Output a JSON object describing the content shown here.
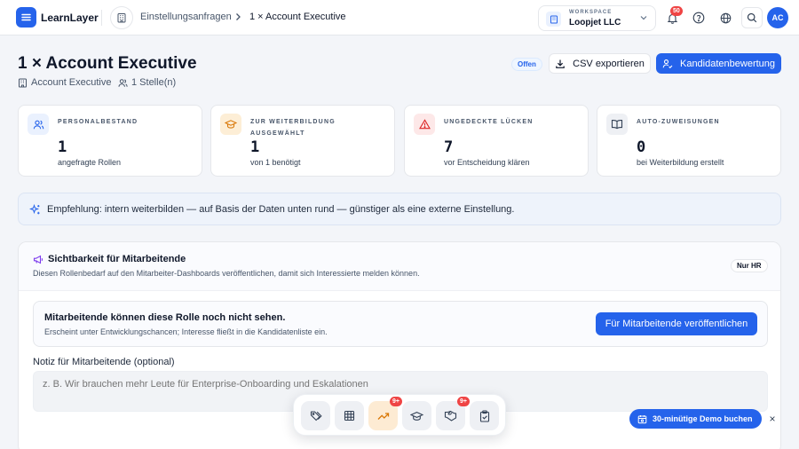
{
  "app": {
    "name": "LearnLayer"
  },
  "breadcrumb": {
    "section": "Einstellungsanfragen",
    "current": "1 × Account Executive"
  },
  "workspace": {
    "label": "WORKSPACE",
    "name": "Loopjet LLC"
  },
  "notifications": {
    "count": "50"
  },
  "user": {
    "initials": "AC"
  },
  "page": {
    "title": "1 × Account Executive",
    "role": "Account Executive",
    "positions": "1 Stelle(n)",
    "status": "Offen",
    "csv_label": "CSV exportieren",
    "evaluate_label": "Kandidatenbewertung"
  },
  "stats": [
    {
      "label": "PERSONALBESTAND",
      "value": "1",
      "desc": "angefragte Rollen",
      "icon": "users-icon",
      "color": "#eaf1fe"
    },
    {
      "label": "ZUR WEITERBILDUNG AUSGEWÄHLT",
      "value": "1",
      "desc": "von 1 benötigt",
      "icon": "graduation-cap-icon",
      "color": "#fdeed6"
    },
    {
      "label": "UNGEDECKTE LÜCKEN",
      "value": "7",
      "desc": "vor Entscheidung klären",
      "icon": "warning-icon",
      "color": "#fde8e8"
    },
    {
      "label": "AUTO-ZUWEISUNGEN",
      "value": "0",
      "desc": "bei Weiterbildung erstellt",
      "icon": "book-icon",
      "color": "#eef0f4"
    }
  ],
  "recommendation": {
    "text": "Empfehlung: intern weiterbilden — auf Basis der Daten unten rund — günstiger als eine externe Einstellung."
  },
  "visibility": {
    "title": "Sichtbarkeit für Mitarbeitende",
    "subtitle": "Diesen Rollenbedarf auf den Mitarbeiter-Dashboards veröffentlichen, damit sich Interessierte melden können.",
    "badge": "Nur HR",
    "notice_title": "Mitarbeitende können diese Rolle noch nicht sehen.",
    "notice_sub": "Erscheint unter Entwicklungschancen; Interesse fließt in die Kandidatenliste ein.",
    "publish_label": "Für Mitarbeitende veröffentlichen",
    "note_label": "Notiz für Mitarbeitende (optional)",
    "note_placeholder": "z. B. Wir brauchen mehr Leute für Enterprise-Onboarding und Eskalationen"
  },
  "dock": [
    {
      "icon": "tags-icon"
    },
    {
      "icon": "table-icon"
    },
    {
      "icon": "trending-up-icon",
      "badge": "9+",
      "active": true
    },
    {
      "icon": "graduation-cap-icon"
    },
    {
      "icon": "handshake-icon",
      "badge": "9+"
    },
    {
      "icon": "clipboard-check-icon"
    }
  ],
  "demo": {
    "label": "30-minütige Demo buchen",
    "close": "×"
  }
}
